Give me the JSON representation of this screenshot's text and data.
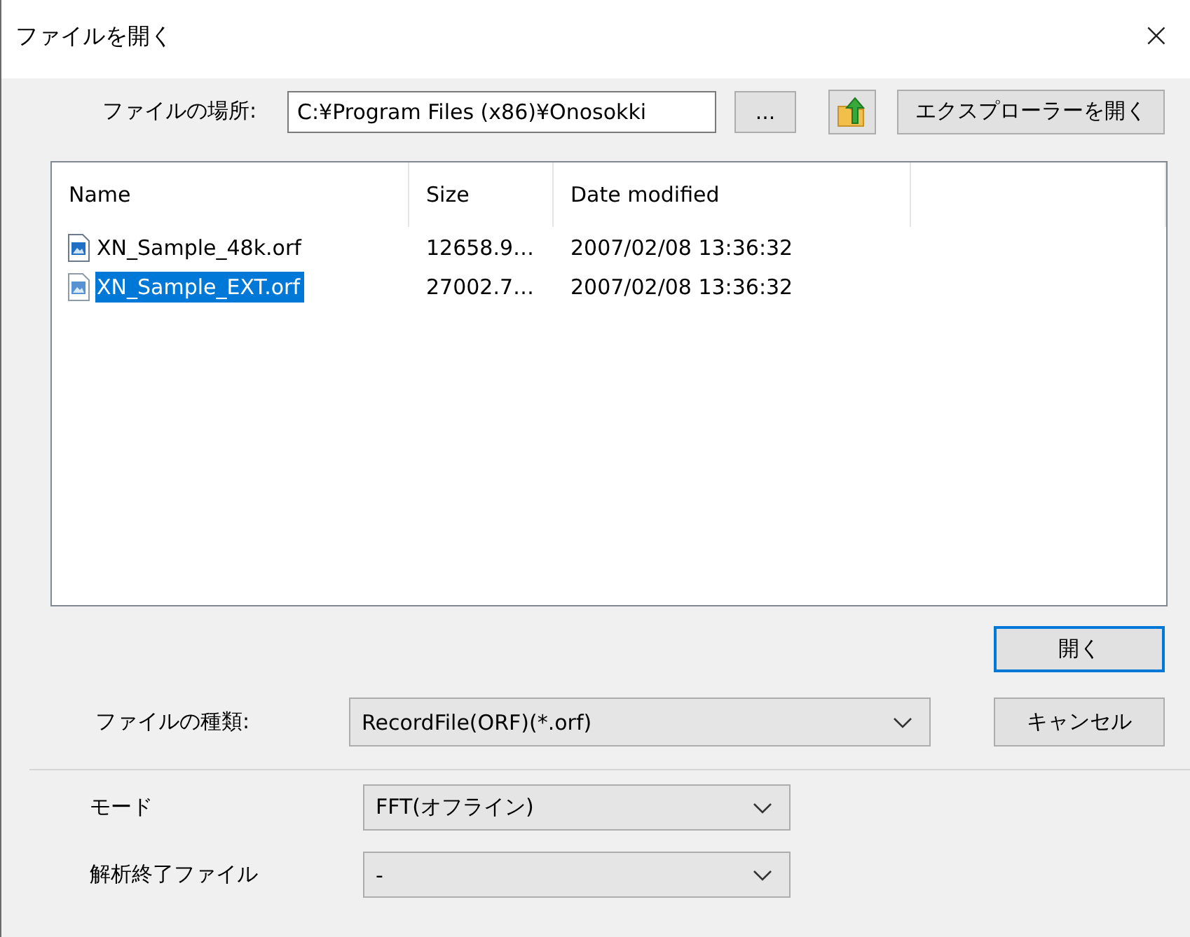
{
  "window": {
    "title": "ファイルを開く",
    "close": "×"
  },
  "location": {
    "label": "ファイルの場所:",
    "value": "C:¥Program Files (x86)¥Onosokki",
    "browse": "...",
    "explorer": "エクスプローラーを開く"
  },
  "file_list": {
    "columns": [
      "Name",
      "Size",
      "Date modified"
    ],
    "rows": [
      {
        "name": "XN_Sample_48k.orf",
        "size": "12658.9…",
        "date": "2007/02/08 13:36:32",
        "selected": false
      },
      {
        "name": "XN_Sample_EXT.orf",
        "size": "27002.7…",
        "date": "2007/02/08 13:36:32",
        "selected": true
      }
    ]
  },
  "open_button": "開く",
  "file_type": {
    "label": "ファイルの種類:",
    "value": "RecordFile(ORF)(*.orf)"
  },
  "cancel_button": "キャンセル",
  "options": [
    {
      "label": "モード",
      "value": "FFT(オフライン)"
    },
    {
      "label": "解析終了ファイル",
      "value": "-"
    }
  ]
}
